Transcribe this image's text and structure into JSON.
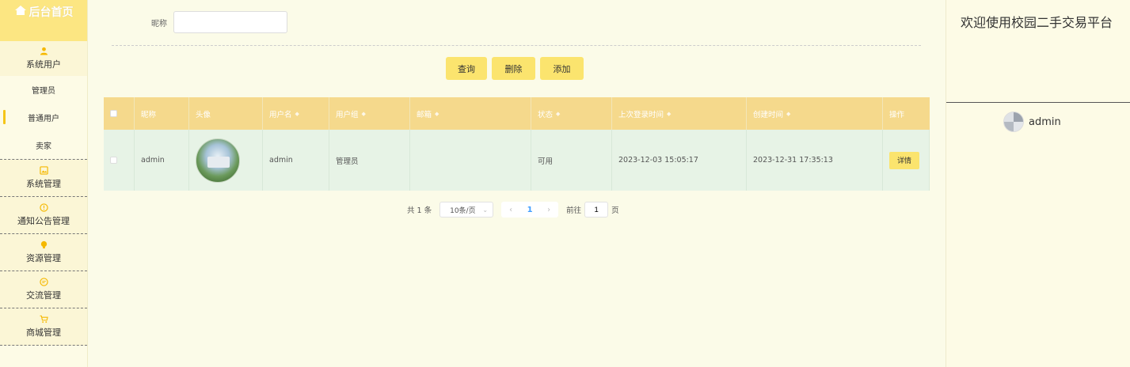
{
  "sidebar": {
    "home_label": "后台首页",
    "groups": [
      {
        "label": "系统用户",
        "items": [
          "管理员",
          "普通用户",
          "卖家"
        ]
      },
      {
        "label": "系统管理"
      },
      {
        "label": "通知公告管理"
      },
      {
        "label": "资源管理"
      },
      {
        "label": "交流管理"
      },
      {
        "label": "商城管理"
      }
    ],
    "active_item": "普通用户"
  },
  "search": {
    "label": "昵称",
    "value": "",
    "placeholder": ""
  },
  "actions": {
    "query": "查询",
    "delete": "删除",
    "add": "添加"
  },
  "table": {
    "headers": [
      "昵称",
      "头像",
      "用户名",
      "用户组",
      "邮箱",
      "状态",
      "上次登录时间",
      "创建时间",
      "操作"
    ],
    "rows": [
      {
        "nickname": "admin",
        "username": "admin",
        "group": "管理员",
        "email": "",
        "status": "可用",
        "last_login": "2023-12-03 15:05:17",
        "created": "2023-12-31 17:35:13",
        "action": "详情"
      }
    ]
  },
  "pagination": {
    "total": "共 1 条",
    "page_size": "10条/页",
    "current_page": "1",
    "goto_label": "前往",
    "goto_value": "1",
    "page_suffix": "页"
  },
  "header": {
    "welcome": "欢迎使用校园二手交易平台",
    "username": "admin"
  },
  "colors": {
    "accent": "#fbe46e",
    "header_bg": "#f5d98c",
    "row_bg": "#e7f3e6",
    "page_bg": "#fbfbe8"
  }
}
